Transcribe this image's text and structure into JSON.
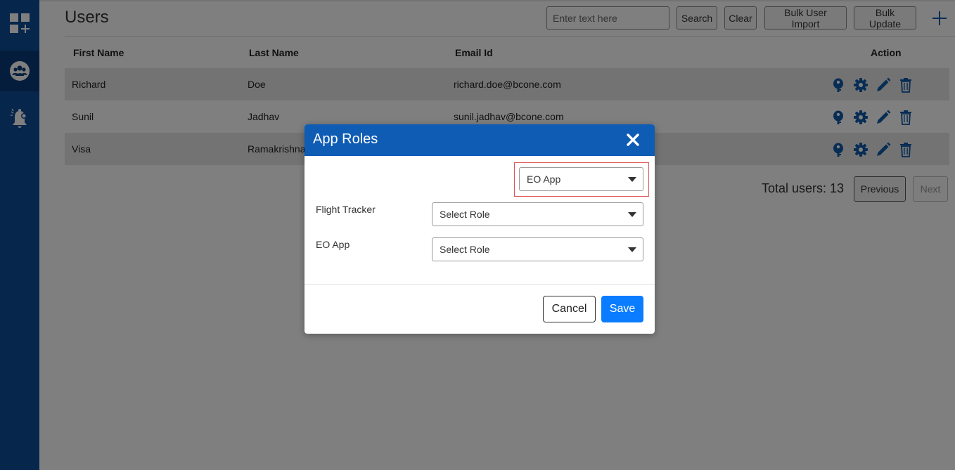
{
  "header": {
    "title": "Users",
    "search_placeholder": "Enter text here",
    "search_label": "Search",
    "clear_label": "Clear",
    "bulk_import_label": "Bulk User Import",
    "bulk_update_label": "Bulk Update"
  },
  "table": {
    "columns": [
      "First Name",
      "Last Name",
      "Email Id",
      "Action"
    ],
    "rows": [
      {
        "first": "Richard",
        "last": "Doe",
        "email": "richard.doe@bcone.com"
      },
      {
        "first": "Sunil",
        "last": "Jadhav",
        "email": "sunil.jadhav@bcone.com"
      },
      {
        "first": "Visa",
        "last": "Ramakrishnan",
        "email": ""
      }
    ]
  },
  "pagination": {
    "total": "Total users: 13",
    "previous_label": "Previous",
    "next_label": "Next"
  },
  "modal": {
    "title": "App Roles",
    "app_select_value": "EO App",
    "fields": [
      {
        "label": "Flight Tracker",
        "value": "Select Role"
      },
      {
        "label": "EO App",
        "value": "Select Role"
      }
    ],
    "cancel_label": "Cancel",
    "save_label": "Save"
  },
  "colors": {
    "sidebar": "#0f4d96",
    "modal_header": "#0f5cb5",
    "save_button": "#0a7cff",
    "action_icon": "#0f5aa8"
  },
  "icons": {
    "sidebar": [
      "dashboard-add-icon",
      "users-group-icon",
      "notification-bell-icon"
    ],
    "actions": [
      "key-icon",
      "gear-icon",
      "pencil-icon",
      "trash-icon"
    ]
  }
}
